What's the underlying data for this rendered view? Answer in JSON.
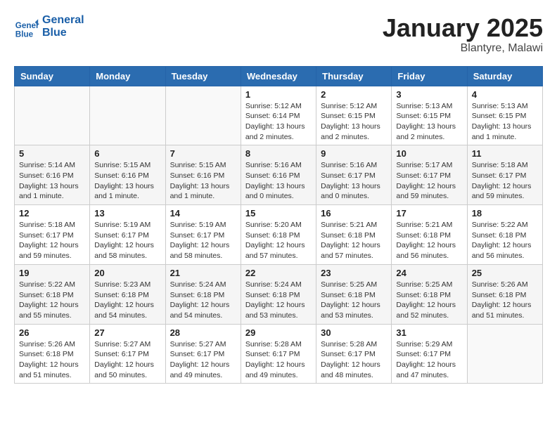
{
  "header": {
    "logo_text_line1": "General",
    "logo_text_line2": "Blue",
    "month": "January 2025",
    "location": "Blantyre, Malawi"
  },
  "days_of_week": [
    "Sunday",
    "Monday",
    "Tuesday",
    "Wednesday",
    "Thursday",
    "Friday",
    "Saturday"
  ],
  "weeks": [
    [
      {
        "day": "",
        "info": ""
      },
      {
        "day": "",
        "info": ""
      },
      {
        "day": "",
        "info": ""
      },
      {
        "day": "1",
        "info": "Sunrise: 5:12 AM\nSunset: 6:14 PM\nDaylight: 13 hours\nand 2 minutes."
      },
      {
        "day": "2",
        "info": "Sunrise: 5:12 AM\nSunset: 6:15 PM\nDaylight: 13 hours\nand 2 minutes."
      },
      {
        "day": "3",
        "info": "Sunrise: 5:13 AM\nSunset: 6:15 PM\nDaylight: 13 hours\nand 2 minutes."
      },
      {
        "day": "4",
        "info": "Sunrise: 5:13 AM\nSunset: 6:15 PM\nDaylight: 13 hours\nand 1 minute."
      }
    ],
    [
      {
        "day": "5",
        "info": "Sunrise: 5:14 AM\nSunset: 6:16 PM\nDaylight: 13 hours\nand 1 minute."
      },
      {
        "day": "6",
        "info": "Sunrise: 5:15 AM\nSunset: 6:16 PM\nDaylight: 13 hours\nand 1 minute."
      },
      {
        "day": "7",
        "info": "Sunrise: 5:15 AM\nSunset: 6:16 PM\nDaylight: 13 hours\nand 1 minute."
      },
      {
        "day": "8",
        "info": "Sunrise: 5:16 AM\nSunset: 6:16 PM\nDaylight: 13 hours\nand 0 minutes."
      },
      {
        "day": "9",
        "info": "Sunrise: 5:16 AM\nSunset: 6:17 PM\nDaylight: 13 hours\nand 0 minutes."
      },
      {
        "day": "10",
        "info": "Sunrise: 5:17 AM\nSunset: 6:17 PM\nDaylight: 12 hours\nand 59 minutes."
      },
      {
        "day": "11",
        "info": "Sunrise: 5:18 AM\nSunset: 6:17 PM\nDaylight: 12 hours\nand 59 minutes."
      }
    ],
    [
      {
        "day": "12",
        "info": "Sunrise: 5:18 AM\nSunset: 6:17 PM\nDaylight: 12 hours\nand 59 minutes."
      },
      {
        "day": "13",
        "info": "Sunrise: 5:19 AM\nSunset: 6:17 PM\nDaylight: 12 hours\nand 58 minutes."
      },
      {
        "day": "14",
        "info": "Sunrise: 5:19 AM\nSunset: 6:17 PM\nDaylight: 12 hours\nand 58 minutes."
      },
      {
        "day": "15",
        "info": "Sunrise: 5:20 AM\nSunset: 6:18 PM\nDaylight: 12 hours\nand 57 minutes."
      },
      {
        "day": "16",
        "info": "Sunrise: 5:21 AM\nSunset: 6:18 PM\nDaylight: 12 hours\nand 57 minutes."
      },
      {
        "day": "17",
        "info": "Sunrise: 5:21 AM\nSunset: 6:18 PM\nDaylight: 12 hours\nand 56 minutes."
      },
      {
        "day": "18",
        "info": "Sunrise: 5:22 AM\nSunset: 6:18 PM\nDaylight: 12 hours\nand 56 minutes."
      }
    ],
    [
      {
        "day": "19",
        "info": "Sunrise: 5:22 AM\nSunset: 6:18 PM\nDaylight: 12 hours\nand 55 minutes."
      },
      {
        "day": "20",
        "info": "Sunrise: 5:23 AM\nSunset: 6:18 PM\nDaylight: 12 hours\nand 54 minutes."
      },
      {
        "day": "21",
        "info": "Sunrise: 5:24 AM\nSunset: 6:18 PM\nDaylight: 12 hours\nand 54 minutes."
      },
      {
        "day": "22",
        "info": "Sunrise: 5:24 AM\nSunset: 6:18 PM\nDaylight: 12 hours\nand 53 minutes."
      },
      {
        "day": "23",
        "info": "Sunrise: 5:25 AM\nSunset: 6:18 PM\nDaylight: 12 hours\nand 53 minutes."
      },
      {
        "day": "24",
        "info": "Sunrise: 5:25 AM\nSunset: 6:18 PM\nDaylight: 12 hours\nand 52 minutes."
      },
      {
        "day": "25",
        "info": "Sunrise: 5:26 AM\nSunset: 6:18 PM\nDaylight: 12 hours\nand 51 minutes."
      }
    ],
    [
      {
        "day": "26",
        "info": "Sunrise: 5:26 AM\nSunset: 6:18 PM\nDaylight: 12 hours\nand 51 minutes."
      },
      {
        "day": "27",
        "info": "Sunrise: 5:27 AM\nSunset: 6:17 PM\nDaylight: 12 hours\nand 50 minutes."
      },
      {
        "day": "28",
        "info": "Sunrise: 5:27 AM\nSunset: 6:17 PM\nDaylight: 12 hours\nand 49 minutes."
      },
      {
        "day": "29",
        "info": "Sunrise: 5:28 AM\nSunset: 6:17 PM\nDaylight: 12 hours\nand 49 minutes."
      },
      {
        "day": "30",
        "info": "Sunrise: 5:28 AM\nSunset: 6:17 PM\nDaylight: 12 hours\nand 48 minutes."
      },
      {
        "day": "31",
        "info": "Sunrise: 5:29 AM\nSunset: 6:17 PM\nDaylight: 12 hours\nand 47 minutes."
      },
      {
        "day": "",
        "info": ""
      }
    ]
  ]
}
